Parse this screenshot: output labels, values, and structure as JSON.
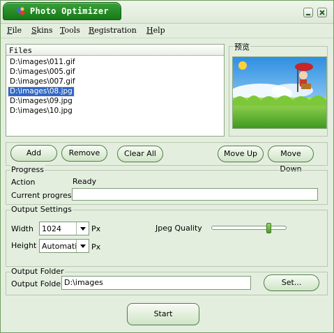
{
  "app": {
    "title": "Photo Optimizer"
  },
  "menu": [
    "File",
    "Skins",
    "Tools",
    "Registration",
    "Help"
  ],
  "files": {
    "header": "Files",
    "items": [
      "D:\\images\\011.gif",
      "D:\\images\\005.gif",
      "D:\\images\\007.gif",
      "D:\\images\\08.jpg",
      "D:\\images\\09.jpg",
      "D:\\images\\10.jpg"
    ],
    "selected_index": 3
  },
  "preview": {
    "label": "预览"
  },
  "buttons": {
    "add": "Add",
    "remove": "Remove",
    "clear_all": "Clear All",
    "move_up": "Move Up",
    "move_down": "Move Down",
    "start": "Start"
  },
  "progress": {
    "legend": "Progress",
    "action_label": "Action",
    "action_value": "Ready",
    "current_label": "Current progress",
    "current_value": ""
  },
  "output_settings": {
    "legend": "Output Settings",
    "width_label": "Width",
    "width_value": "1024",
    "height_label": "Height",
    "height_value": "Automatic",
    "unit": "Px",
    "jpeg_quality_label": "Jpeg Quality",
    "jpeg_quality_fraction": 0.78
  },
  "output_folder": {
    "legend": "Output Folder",
    "label": "Output Folder",
    "value": "D:\\images",
    "set_button": "Set..."
  },
  "colors": {
    "title_green": "#1f8a1f",
    "window_bg": "#e4eedf",
    "selection": "#3168c5",
    "button_border": "#4d7d43"
  }
}
